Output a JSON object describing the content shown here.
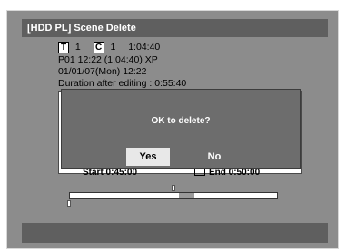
{
  "screen": {
    "title": "[HDD PL] Scene Delete",
    "title_box_marker": "T",
    "title_number": "1",
    "chapter_box_marker": "C",
    "chapter_number": "1",
    "total_time": "1:04:40",
    "program_line": "P01  12:22 (1:04:40) XP",
    "date_line": "01/01/07(Mon)  12:22",
    "duration_line": "Duration after editing : 0:55:40"
  },
  "edit_points": {
    "start_label": "Start  0:45:00",
    "end_label": "End  0:50:00"
  },
  "timeline": {
    "deleted_fraction_start": 0.52,
    "deleted_fraction_end": 0.6
  },
  "dialog": {
    "message": "OK to delete?",
    "yes_label": "Yes",
    "no_label": "No"
  },
  "colors": {
    "frame": "#8c8c8c",
    "title_bar": "#5f5f5f",
    "dialog": "#6d6d6d",
    "selected_button": "#e8e8e8"
  }
}
